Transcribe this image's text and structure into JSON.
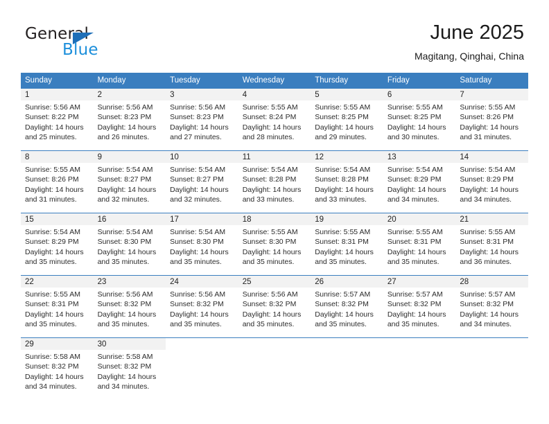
{
  "logo": {
    "word_general": "General",
    "word_blue": "Blue",
    "triangle_color": "#1e6fb8",
    "blue_color": "#1c8fdb"
  },
  "header": {
    "title": "June 2025",
    "location": "Magitang, Qinghai, China"
  },
  "colors": {
    "header_blue": "#3a7ebf",
    "daynum_band": "#f2f2f2",
    "text": "#222222"
  },
  "weekday_headers": [
    "Sunday",
    "Monday",
    "Tuesday",
    "Wednesday",
    "Thursday",
    "Friday",
    "Saturday"
  ],
  "weeks": [
    [
      {
        "day": "1",
        "sunrise": "Sunrise: 5:56 AM",
        "sunset": "Sunset: 8:22 PM",
        "daylight1": "Daylight: 14 hours",
        "daylight2": "and 25 minutes."
      },
      {
        "day": "2",
        "sunrise": "Sunrise: 5:56 AM",
        "sunset": "Sunset: 8:23 PM",
        "daylight1": "Daylight: 14 hours",
        "daylight2": "and 26 minutes."
      },
      {
        "day": "3",
        "sunrise": "Sunrise: 5:56 AM",
        "sunset": "Sunset: 8:23 PM",
        "daylight1": "Daylight: 14 hours",
        "daylight2": "and 27 minutes."
      },
      {
        "day": "4",
        "sunrise": "Sunrise: 5:55 AM",
        "sunset": "Sunset: 8:24 PM",
        "daylight1": "Daylight: 14 hours",
        "daylight2": "and 28 minutes."
      },
      {
        "day": "5",
        "sunrise": "Sunrise: 5:55 AM",
        "sunset": "Sunset: 8:25 PM",
        "daylight1": "Daylight: 14 hours",
        "daylight2": "and 29 minutes."
      },
      {
        "day": "6",
        "sunrise": "Sunrise: 5:55 AM",
        "sunset": "Sunset: 8:25 PM",
        "daylight1": "Daylight: 14 hours",
        "daylight2": "and 30 minutes."
      },
      {
        "day": "7",
        "sunrise": "Sunrise: 5:55 AM",
        "sunset": "Sunset: 8:26 PM",
        "daylight1": "Daylight: 14 hours",
        "daylight2": "and 31 minutes."
      }
    ],
    [
      {
        "day": "8",
        "sunrise": "Sunrise: 5:55 AM",
        "sunset": "Sunset: 8:26 PM",
        "daylight1": "Daylight: 14 hours",
        "daylight2": "and 31 minutes."
      },
      {
        "day": "9",
        "sunrise": "Sunrise: 5:54 AM",
        "sunset": "Sunset: 8:27 PM",
        "daylight1": "Daylight: 14 hours",
        "daylight2": "and 32 minutes."
      },
      {
        "day": "10",
        "sunrise": "Sunrise: 5:54 AM",
        "sunset": "Sunset: 8:27 PM",
        "daylight1": "Daylight: 14 hours",
        "daylight2": "and 32 minutes."
      },
      {
        "day": "11",
        "sunrise": "Sunrise: 5:54 AM",
        "sunset": "Sunset: 8:28 PM",
        "daylight1": "Daylight: 14 hours",
        "daylight2": "and 33 minutes."
      },
      {
        "day": "12",
        "sunrise": "Sunrise: 5:54 AM",
        "sunset": "Sunset: 8:28 PM",
        "daylight1": "Daylight: 14 hours",
        "daylight2": "and 33 minutes."
      },
      {
        "day": "13",
        "sunrise": "Sunrise: 5:54 AM",
        "sunset": "Sunset: 8:29 PM",
        "daylight1": "Daylight: 14 hours",
        "daylight2": "and 34 minutes."
      },
      {
        "day": "14",
        "sunrise": "Sunrise: 5:54 AM",
        "sunset": "Sunset: 8:29 PM",
        "daylight1": "Daylight: 14 hours",
        "daylight2": "and 34 minutes."
      }
    ],
    [
      {
        "day": "15",
        "sunrise": "Sunrise: 5:54 AM",
        "sunset": "Sunset: 8:29 PM",
        "daylight1": "Daylight: 14 hours",
        "daylight2": "and 35 minutes."
      },
      {
        "day": "16",
        "sunrise": "Sunrise: 5:54 AM",
        "sunset": "Sunset: 8:30 PM",
        "daylight1": "Daylight: 14 hours",
        "daylight2": "and 35 minutes."
      },
      {
        "day": "17",
        "sunrise": "Sunrise: 5:54 AM",
        "sunset": "Sunset: 8:30 PM",
        "daylight1": "Daylight: 14 hours",
        "daylight2": "and 35 minutes."
      },
      {
        "day": "18",
        "sunrise": "Sunrise: 5:55 AM",
        "sunset": "Sunset: 8:30 PM",
        "daylight1": "Daylight: 14 hours",
        "daylight2": "and 35 minutes."
      },
      {
        "day": "19",
        "sunrise": "Sunrise: 5:55 AM",
        "sunset": "Sunset: 8:31 PM",
        "daylight1": "Daylight: 14 hours",
        "daylight2": "and 35 minutes."
      },
      {
        "day": "20",
        "sunrise": "Sunrise: 5:55 AM",
        "sunset": "Sunset: 8:31 PM",
        "daylight1": "Daylight: 14 hours",
        "daylight2": "and 35 minutes."
      },
      {
        "day": "21",
        "sunrise": "Sunrise: 5:55 AM",
        "sunset": "Sunset: 8:31 PM",
        "daylight1": "Daylight: 14 hours",
        "daylight2": "and 36 minutes."
      }
    ],
    [
      {
        "day": "22",
        "sunrise": "Sunrise: 5:55 AM",
        "sunset": "Sunset: 8:31 PM",
        "daylight1": "Daylight: 14 hours",
        "daylight2": "and 35 minutes."
      },
      {
        "day": "23",
        "sunrise": "Sunrise: 5:56 AM",
        "sunset": "Sunset: 8:32 PM",
        "daylight1": "Daylight: 14 hours",
        "daylight2": "and 35 minutes."
      },
      {
        "day": "24",
        "sunrise": "Sunrise: 5:56 AM",
        "sunset": "Sunset: 8:32 PM",
        "daylight1": "Daylight: 14 hours",
        "daylight2": "and 35 minutes."
      },
      {
        "day": "25",
        "sunrise": "Sunrise: 5:56 AM",
        "sunset": "Sunset: 8:32 PM",
        "daylight1": "Daylight: 14 hours",
        "daylight2": "and 35 minutes."
      },
      {
        "day": "26",
        "sunrise": "Sunrise: 5:57 AM",
        "sunset": "Sunset: 8:32 PM",
        "daylight1": "Daylight: 14 hours",
        "daylight2": "and 35 minutes."
      },
      {
        "day": "27",
        "sunrise": "Sunrise: 5:57 AM",
        "sunset": "Sunset: 8:32 PM",
        "daylight1": "Daylight: 14 hours",
        "daylight2": "and 35 minutes."
      },
      {
        "day": "28",
        "sunrise": "Sunrise: 5:57 AM",
        "sunset": "Sunset: 8:32 PM",
        "daylight1": "Daylight: 14 hours",
        "daylight2": "and 34 minutes."
      }
    ],
    [
      {
        "day": "29",
        "sunrise": "Sunrise: 5:58 AM",
        "sunset": "Sunset: 8:32 PM",
        "daylight1": "Daylight: 14 hours",
        "daylight2": "and 34 minutes."
      },
      {
        "day": "30",
        "sunrise": "Sunrise: 5:58 AM",
        "sunset": "Sunset: 8:32 PM",
        "daylight1": "Daylight: 14 hours",
        "daylight2": "and 34 minutes."
      },
      {
        "day": "",
        "sunrise": "",
        "sunset": "",
        "daylight1": "",
        "daylight2": ""
      },
      {
        "day": "",
        "sunrise": "",
        "sunset": "",
        "daylight1": "",
        "daylight2": ""
      },
      {
        "day": "",
        "sunrise": "",
        "sunset": "",
        "daylight1": "",
        "daylight2": ""
      },
      {
        "day": "",
        "sunrise": "",
        "sunset": "",
        "daylight1": "",
        "daylight2": ""
      },
      {
        "day": "",
        "sunrise": "",
        "sunset": "",
        "daylight1": "",
        "daylight2": ""
      }
    ]
  ]
}
